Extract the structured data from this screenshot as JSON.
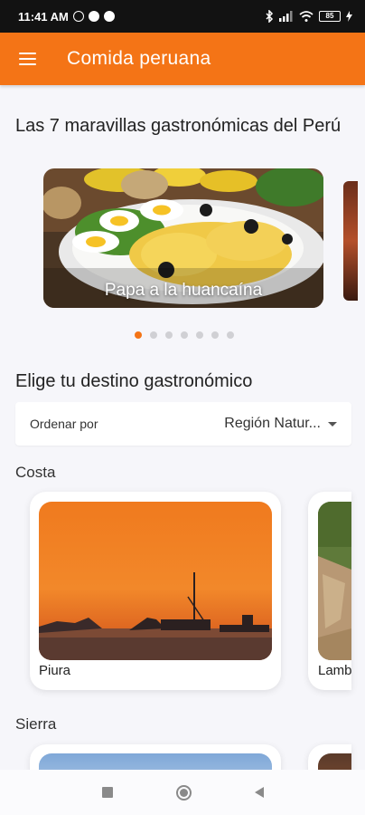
{
  "status_bar": {
    "time": "11:41 AM",
    "battery": "85"
  },
  "app_bar": {
    "title": "Comida peruana"
  },
  "wonders": {
    "heading": "Las 7 maravillas gastronómicas del Perú",
    "slides": [
      {
        "caption": "Papa a la huancaína"
      }
    ],
    "page_count": 7,
    "active_index": 0
  },
  "destination": {
    "heading": "Elige tu destino gastronómico",
    "sort_label": "Ordenar por",
    "sort_value": "Región Natur..."
  },
  "regions": [
    {
      "name": "Costa",
      "cities": [
        {
          "name": "Piura"
        },
        {
          "name": "Lamb"
        }
      ]
    },
    {
      "name": "Sierra",
      "cities": []
    }
  ],
  "colors": {
    "accent": "#f47416",
    "background": "#f6f6fa",
    "status_bar": "#121212"
  }
}
